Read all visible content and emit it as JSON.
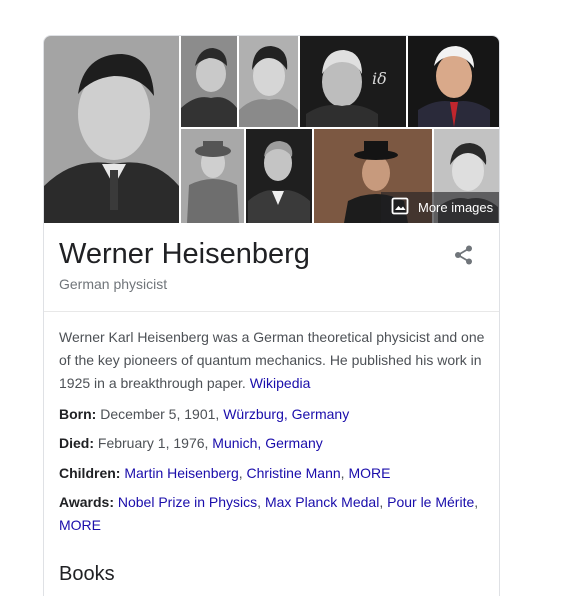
{
  "gallery": {
    "more_images_label": "More images",
    "tiles": [
      {
        "name": "portrait-main"
      },
      {
        "name": "portrait-young"
      },
      {
        "name": "portrait-side"
      },
      {
        "name": "portrait-chalkboard"
      },
      {
        "name": "portrait-red-tie"
      },
      {
        "name": "portrait-hat"
      },
      {
        "name": "portrait-older"
      },
      {
        "name": "portrait-heisenberg-character"
      },
      {
        "name": "portrait-smiling"
      }
    ]
  },
  "entity": {
    "title": "Werner Heisenberg",
    "subtitle": "German physicist"
  },
  "description": {
    "text": "Werner Karl Heisenberg was a German theoretical physicist and one of the key pioneers of quantum mechanics. He published his work in 1925 in a breakthrough paper. ",
    "source_link": "Wikipedia"
  },
  "facts": {
    "born": {
      "label": "Born:",
      "text": " December 5, 1901, ",
      "link": "Würzburg, Germany"
    },
    "died": {
      "label": "Died:",
      "text": " February 1, 1976, ",
      "link": "Munich, Germany"
    },
    "children": {
      "label": "Children:",
      "links": [
        "Martin Heisenberg",
        "Christine Mann",
        "MORE"
      ]
    },
    "awards": {
      "label": "Awards:",
      "links": [
        "Nobel Prize in Physics",
        "Max Planck Medal",
        "Pour le Mérite",
        "MORE"
      ]
    }
  },
  "partial_section_heading": "Books",
  "icons": {
    "share": "share-icon",
    "images": "image-icon"
  }
}
